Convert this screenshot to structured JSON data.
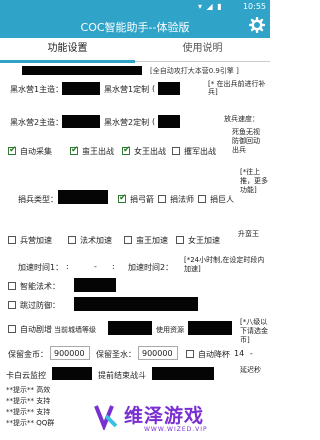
{
  "status_bar": {
    "time": "10:55",
    "icons": "▾ ◢ ▮"
  },
  "app": {
    "title": "COC智能助手--体验版"
  },
  "tabs": [
    {
      "label": "功能设置"
    },
    {
      "label": "使用说明"
    }
  ],
  "rows": {
    "top_partial": "[全自动攻打大本营0.9引擎 ]",
    "main_label_1": "黑水营1主造：",
    "sub_label_1": "黑水营1定制",
    "side_note_1": "[* 在出兵前进行补兵]",
    "main_label_2": "黑水营2主造：",
    "sub_label_2": "黑水营2定制",
    "side_note_2": "放兵速度：",
    "auto_collect": "自动采集",
    "king_attack": "蛮王出战",
    "queen_attack": "女王出战",
    "siege_attack": "攫军出战",
    "death_note": "死鱼无视防御回动出兵",
    "deploy_type_label": "捐兵类型：",
    "deploy_archer": "捐弓箭",
    "deploy_wizard": "捐法师",
    "deploy_giant": "捐巨人",
    "deploy_note": "[*往上推，更多功能]",
    "boost_barracks": "兵营加速",
    "boost_spell": "法术加速",
    "boost_king": "蛮王加速",
    "boost_queen": "女王加速",
    "upgrade_note": "升蛮王",
    "boost_time_label": "加速时间1：",
    "boost_time_2": "加速时间2：",
    "boost_hint": "[*24小时制,在设定时段内加速]",
    "smart_spell": "智能法术：",
    "skip_defense": "跳过防御：",
    "auto_donate": "自动剧增",
    "town_level_label": "当前城墙等级",
    "use_resource_label": "使用资源",
    "donate_note": "[*八级以下请选金币]",
    "gold_label": "保留金币：",
    "gold_value": "900000",
    "elixir_label": "保留圣水：",
    "elixir_value": "900000",
    "auto_drop": "自动降杯",
    "drop_value": "14",
    "monitor_label": "卡白云监控",
    "end_label": "提前结束战斗",
    "delay_label": "延迟秒",
    "tip1": "**提示**  高效",
    "tip2": "**提示**  支持",
    "tip3": "**提示**  支持",
    "tip4": "**提示**  QQ群"
  },
  "watermark": {
    "text": "维泽游戏",
    "url": "WWW.WIZED.VIP"
  },
  "colors": {
    "brand": "#30a3c9",
    "check": "#2e7d32",
    "watermark": "#7a2fd0"
  }
}
